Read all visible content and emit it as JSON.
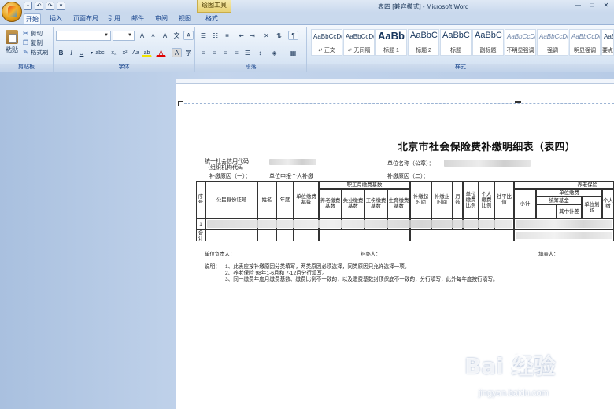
{
  "window": {
    "title": "表四 [兼容模式] - Microsoft Word",
    "context_tab": "绘图工具",
    "controls": [
      "—",
      "□",
      "✕"
    ]
  },
  "tabs": [
    {
      "label": "开始",
      "active": true
    },
    {
      "label": "插入"
    },
    {
      "label": "页面布局"
    },
    {
      "label": "引用"
    },
    {
      "label": "邮件"
    },
    {
      "label": "审阅"
    },
    {
      "label": "视图"
    },
    {
      "label": "格式"
    }
  ],
  "ribbon": {
    "clipboard": {
      "paste": "粘贴",
      "cut": "剪切",
      "copy": "复制",
      "format_painter": "格式刷",
      "label": "剪贴板"
    },
    "font": {
      "label": "字体",
      "bold": "B",
      "italic": "I",
      "underline": "U",
      "strike": "abc",
      "sub": "x₂",
      "sup": "x²",
      "change_case": "Aa",
      "grow": "A",
      "shrink": "A",
      "clear": "A",
      "phonetic": "文",
      "border": "A",
      "color_a": "A",
      "highlight": "ab",
      "char_shade": "A",
      "enclose": "字"
    },
    "paragraph": {
      "label": "段落"
    },
    "styles": {
      "label": "样式",
      "items": [
        {
          "preview": "AaBbCcDd",
          "name": "↵ 正文"
        },
        {
          "preview": "AaBbCcDd",
          "name": "↵ 无间隔"
        },
        {
          "preview": "AaBb",
          "name": "标题 1"
        },
        {
          "preview": "AaBbC",
          "name": "标题 2"
        },
        {
          "preview": "AaBbC",
          "name": "标题"
        },
        {
          "preview": "AaBbC",
          "name": "副标题"
        },
        {
          "preview": "AaBbCcDd",
          "name": "不明显强调"
        },
        {
          "preview": "AaBbCcDd",
          "name": "强调"
        },
        {
          "preview": "AaBbCcDd",
          "name": "明显强调"
        },
        {
          "preview": "AaBbCcDd",
          "name": "要点"
        }
      ]
    }
  },
  "document": {
    "title": "北京市社会保险费补缴明细表（表四）",
    "credit_code_label": "统一社会信用代码",
    "org_code_label": "（组织机构代码",
    "unit_name_label": "单位名称（公章）：",
    "reason1_label": "补缴原因（一）：",
    "reason1_value": "单位申报个人补缴",
    "reason2_label": "补缴原因（二）：",
    "table": {
      "h_seq": "序号",
      "h_id": "公民身份证号",
      "h_name": "姓名",
      "h_year": "年度",
      "h_unit_base": "单位缴费基数",
      "h_group": "职工月缴费基数",
      "h_pension_base": "养老缴费基数",
      "h_unemp_base": "失业缴费基数",
      "h_injury_base": "工伤缴费基数",
      "h_maternity_base": "生育缴费基数",
      "h_start": "补缴起时间",
      "h_end": "补缴止时间",
      "h_months": "月数",
      "h_unit_rate": "单位缴费比例",
      "h_person_rate": "个人缴费比例",
      "h_social_avg": "社平比值",
      "h_pension_group": "养老保险",
      "h_subtotal": "小计",
      "h_unit_pay": "单位缴费",
      "h_pool_fund": "统筹基金",
      "h_of_which": "其中补差",
      "h_unit_transfer": "单位划转",
      "h_personal": "个人缴",
      "row1_seq": "1",
      "total_label": "合计"
    },
    "sign_unit": "单位负责人：",
    "sign_handler": "经办人：",
    "sign_filler": "填表人：",
    "notes_label": "说明：",
    "note1": "1、此表应按补缴原因分类填写，两类原因必须选择，同类原因只允许选择一项。",
    "note2": "2、养老保险 98年1-6月和 7-12月分行填写。",
    "note3": "3、同一缴费年度月缴费基数、缴费比例不一致的，以及缴费基数封顶保底不一致的，分行填写，此外每年度按行填写。"
  },
  "watermark": {
    "logo": "Bai  经验",
    "url": "jingyan.baidu.com"
  }
}
